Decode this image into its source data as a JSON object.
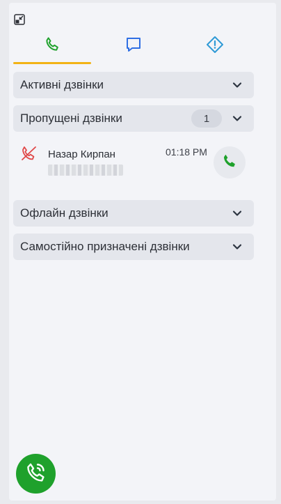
{
  "icons": {
    "collapse": "collapse-window-icon",
    "tab_calls": "phone-icon",
    "tab_chats": "chat-bubble-icon",
    "tab_alerts": "warning-diamond-icon",
    "chevron": "chevron-down-icon",
    "missed": "missed-call-icon",
    "callback": "phone-icon",
    "fab": "phone-ringing-icon"
  },
  "colors": {
    "accent_tab": "#f2b316",
    "call_green": "#1fa12c",
    "chat_blue": "#2f6fe4",
    "alert_blue": "#2f9ad6",
    "missed_red": "#e04848"
  },
  "tabs": [
    {
      "id": "calls",
      "active": true
    },
    {
      "id": "chats",
      "active": false
    },
    {
      "id": "alerts",
      "active": false
    }
  ],
  "sections": {
    "active": {
      "label": "Активні дзвінки"
    },
    "missed": {
      "label": "Пропущені дзвінки",
      "count": "1"
    },
    "offline": {
      "label": "Офлайн дзвінки"
    },
    "self_assigned": {
      "label": "Самостійно призначені дзвінки"
    }
  },
  "missed_calls": [
    {
      "name": "Назар Кирпан",
      "time": "01:18 PM"
    }
  ]
}
